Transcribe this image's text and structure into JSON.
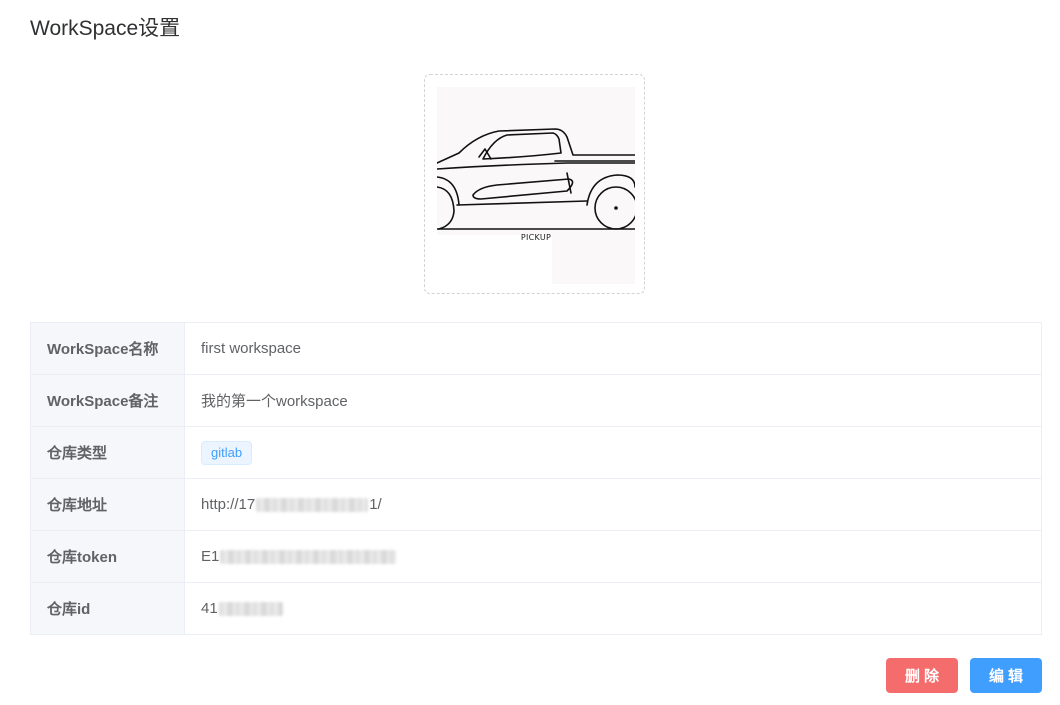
{
  "page": {
    "title": "WorkSpace设置"
  },
  "uploader": {
    "image_caption": "PICKUP",
    "icon": "pickup-truck-image"
  },
  "info_rows": [
    {
      "label": "WorkSpace名称",
      "value": "first workspace"
    },
    {
      "label": "WorkSpace备注",
      "value": "我的第一个workspace"
    },
    {
      "label": "仓库类型",
      "value": "gitlab"
    },
    {
      "label": "仓库地址",
      "value_prefix": "http://17",
      "value_suffix": "1/"
    },
    {
      "label": "仓库token",
      "value_prefix": "E1"
    },
    {
      "label": "仓库id",
      "value_prefix": "41"
    }
  ],
  "actions": {
    "delete_label": "删除",
    "edit_label": "编辑"
  },
  "colors": {
    "primary": "#409eff",
    "danger": "#f56c6c",
    "label_bg": "#f5f7fa",
    "border": "#ebeef5"
  }
}
